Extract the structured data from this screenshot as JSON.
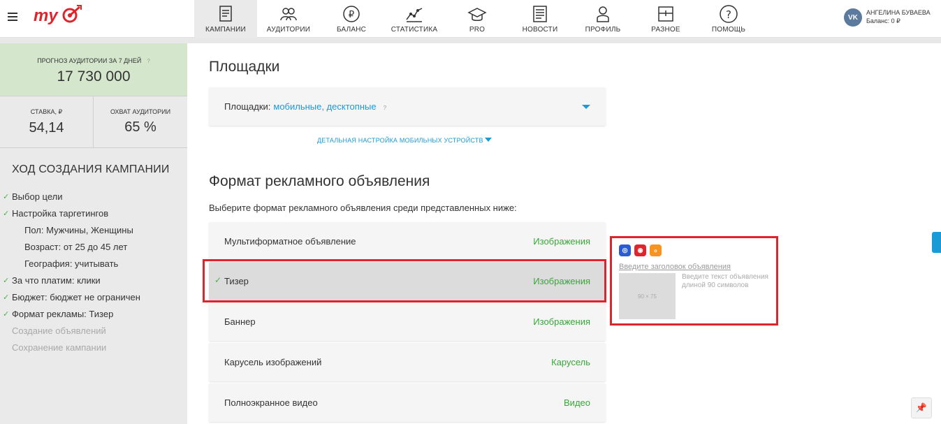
{
  "header": {
    "nav": [
      {
        "label": "КАМПАНИИ",
        "icon": "campaigns-icon",
        "active": true
      },
      {
        "label": "АУДИТОРИИ",
        "icon": "audiences-icon"
      },
      {
        "label": "БАЛАНС",
        "icon": "ruble-icon"
      },
      {
        "label": "СТАТИСТИКА",
        "icon": "chart-icon"
      },
      {
        "label": "PRO",
        "icon": "graduation-cap-icon"
      },
      {
        "label": "НОВОСТИ",
        "icon": "news-icon"
      },
      {
        "label": "ПРОФИЛЬ",
        "icon": "profile-icon"
      },
      {
        "label": "РАЗНОЕ",
        "icon": "misc-icon"
      },
      {
        "label": "ПОМОЩЬ",
        "icon": "help-icon"
      }
    ],
    "user": {
      "name": "АНГЕЛИНА БУВАЕВА",
      "balance": "Баланс: 0 ₽",
      "vk_label": "VK"
    }
  },
  "sidebar": {
    "forecast": {
      "label": "ПРОГНОЗ АУДИТОРИИ ЗА 7 ДНЕЙ",
      "hint": "?",
      "value": "17 730 000"
    },
    "rate": {
      "label": "СТАВКА, ₽",
      "value": "54,14"
    },
    "reach": {
      "label": "ОХВАТ АУДИТОРИИ",
      "value": "65 %"
    },
    "progress_title": "ХОД СОЗДАНИЯ КАМПАНИИ",
    "steps": [
      {
        "text": "Выбор цели",
        "state": "done"
      },
      {
        "text": "Настройка таргетингов",
        "state": "done"
      },
      {
        "text": "Пол: Мужчины, Женщины",
        "state": "sub"
      },
      {
        "text": "Возраст: от 25 до 45 лет",
        "state": "sub"
      },
      {
        "text": "География: учитывать",
        "state": "sub"
      },
      {
        "text": "За что платим: клики",
        "state": "done"
      },
      {
        "text": "Бюджет: бюджет не ограничен",
        "state": "done"
      },
      {
        "text": "Формат рекламы: Тизер",
        "state": "done"
      },
      {
        "text": "Создание объявлений",
        "state": "pending"
      },
      {
        "text": "Сохранение кампании",
        "state": "pending"
      }
    ]
  },
  "main": {
    "platforms_heading": "Площадки",
    "platforms_label": "Площадки:",
    "platforms_value": "мобильные, десктопные",
    "platforms_hint": "?",
    "mobile_link": "ДЕТАЛЬНАЯ НАСТРОЙКА МОБИЛЬНЫХ УСТРОЙСТВ",
    "format_heading": "Формат рекламного объявления",
    "format_subtitle": "Выберите формат рекламного объявления среди представленных ниже:",
    "formats": [
      {
        "name": "Мультиформатное объявление",
        "type": "Изображения",
        "selected": false
      },
      {
        "name": "Тизер",
        "type": "Изображения",
        "selected": true
      },
      {
        "name": "Баннер",
        "type": "Изображения",
        "selected": false
      },
      {
        "name": "Карусель изображений",
        "type": "Карусель",
        "selected": false
      },
      {
        "name": "Полноэкранное видео",
        "type": "Видео",
        "selected": false
      }
    ]
  },
  "preview": {
    "title_placeholder": "Введите заголовок объявления",
    "image_size": "90 × 75",
    "text_placeholder": "Введите текст объявления длиной 90 символов",
    "icons": [
      "target-icon",
      "mytarget-icon",
      "odnoklassniki-icon"
    ]
  },
  "colors": {
    "accent": "#1a9ad6",
    "green": "#3aa53a",
    "highlight": "#e0242c",
    "forecast_bg": "#d4e7cc"
  }
}
